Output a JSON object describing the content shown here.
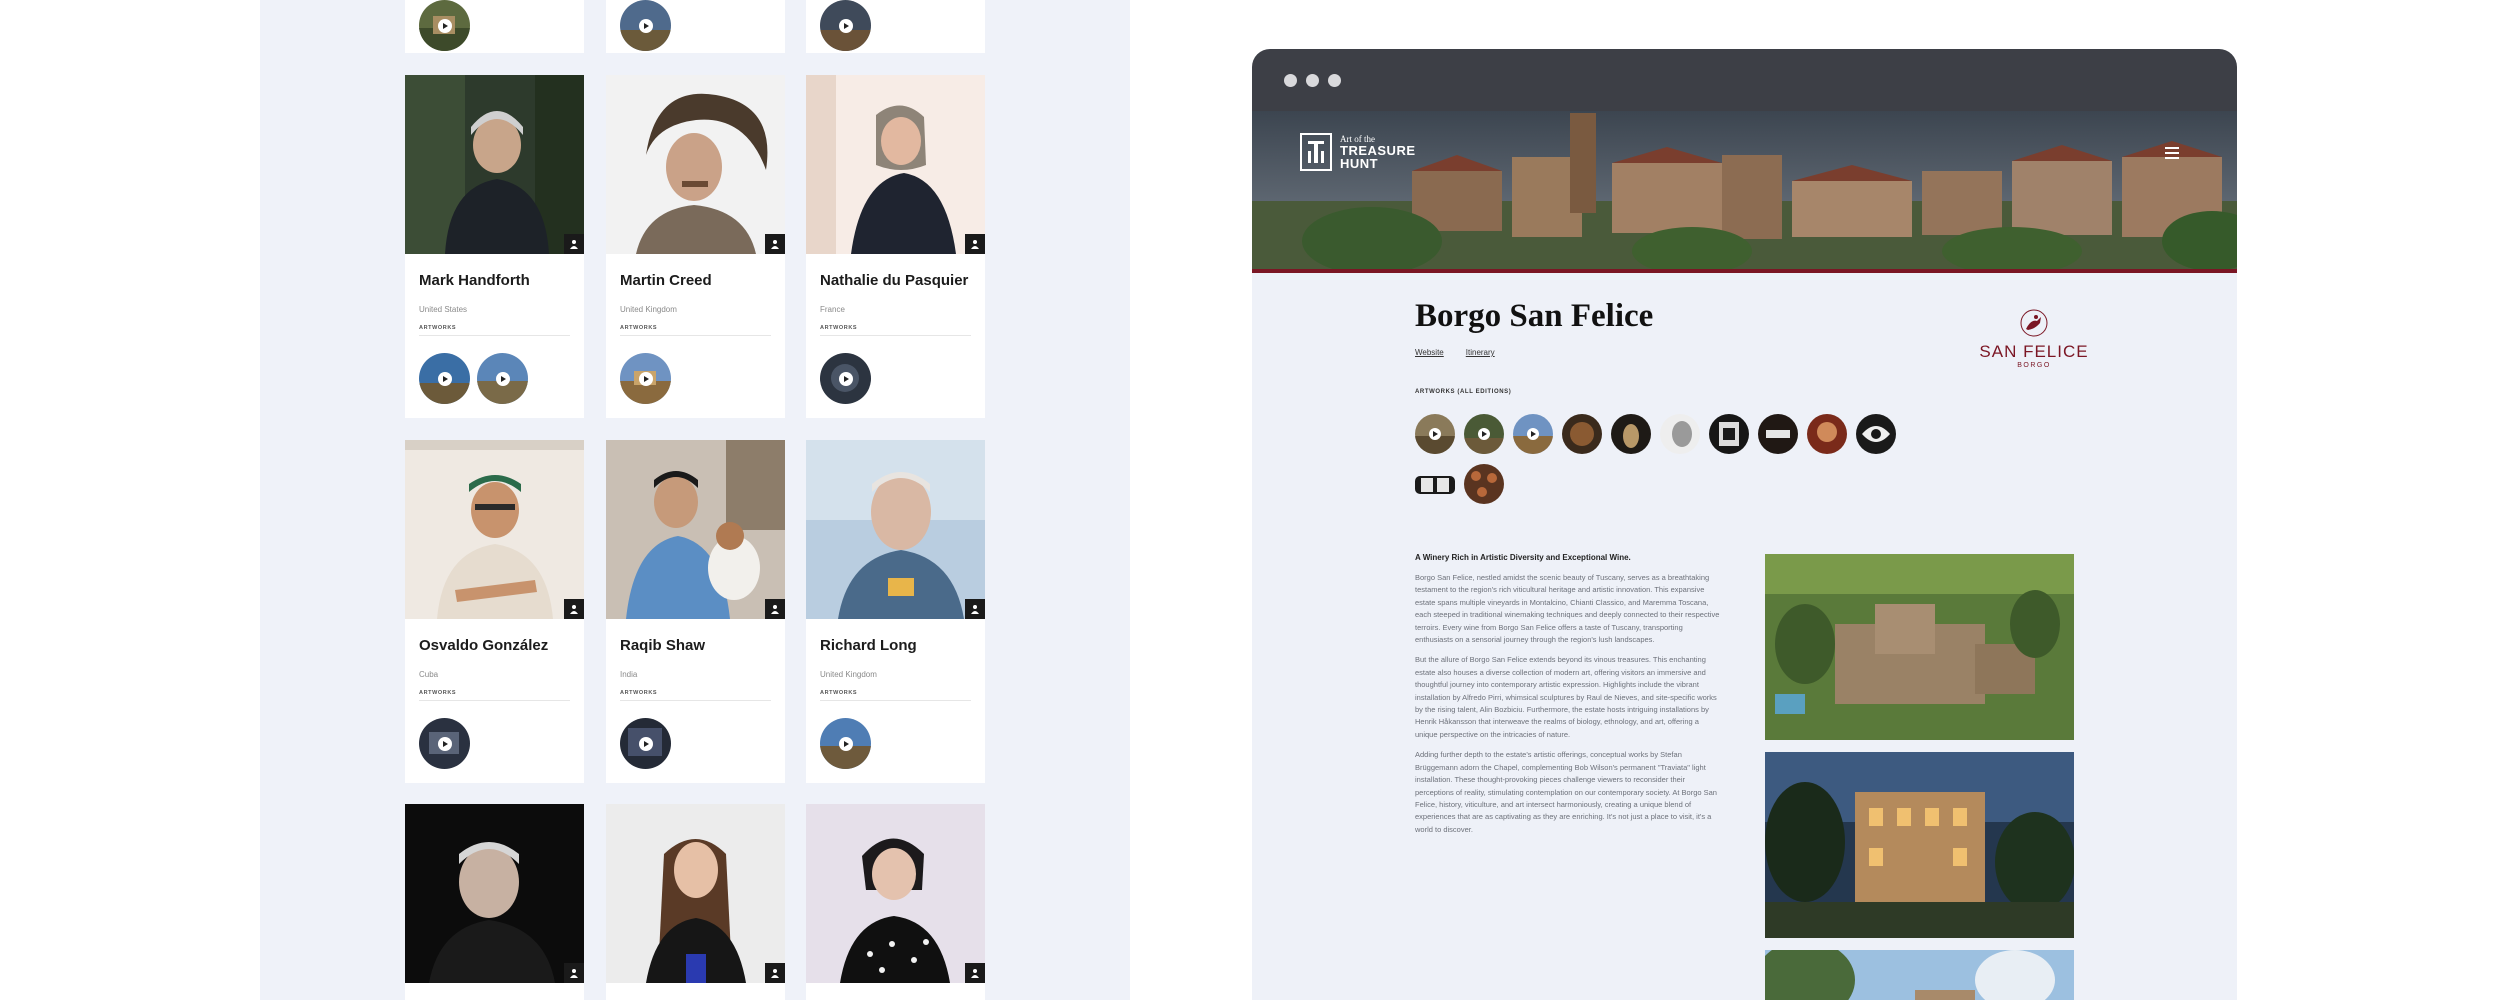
{
  "artists": [
    {
      "name": "Mark Handforth",
      "country": "United States",
      "artworks_label": "ARTWORKS",
      "artwork_count": 2
    },
    {
      "name": "Martin Creed",
      "country": "United Kingdom",
      "artworks_label": "ARTWORKS",
      "artwork_count": 1
    },
    {
      "name": "Nathalie du Pasquier",
      "country": "France",
      "artworks_label": "ARTWORKS",
      "artwork_count": 1
    },
    {
      "name": "Osvaldo González",
      "country": "Cuba",
      "artworks_label": "ARTWORKS",
      "artwork_count": 1
    },
    {
      "name": "Raqib Shaw",
      "country": "India",
      "artworks_label": "ARTWORKS",
      "artwork_count": 1
    },
    {
      "name": "Richard Long",
      "country": "United Kingdom",
      "artworks_label": "ARTWORKS",
      "artwork_count": 1
    }
  ],
  "browser": {
    "logo": {
      "line1": "Art of the",
      "line2": "TREASURE",
      "line3": "HUNT"
    },
    "page_title": "Borgo San Felice",
    "links": {
      "website": "Website",
      "itinerary": "Itinerary"
    },
    "brand": {
      "name": "SAN FELICE",
      "sub": "BORGO"
    },
    "artworks_label": "ARTWORKS (ALL EDITIONS)",
    "artwork_thumb_count": 12,
    "article": {
      "lead": "A Winery Rich in Artistic Diversity and Exceptional Wine.",
      "p1": "Borgo San Felice, nestled amidst the scenic beauty of Tuscany, serves as a breathtaking testament to the region's rich viticultural heritage and artistic innovation. This expansive estate spans multiple vineyards in Montalcino, Chianti Classico, and Maremma Toscana, each steeped in traditional winemaking techniques and deeply connected to their respective terroirs. Every wine from Borgo San Felice offers a taste of Tuscany, transporting enthusiasts on a sensorial journey through the region's lush landscapes.",
      "p2": "But the allure of Borgo San Felice extends beyond its vinous treasures. This enchanting estate also houses a diverse collection of modern art, offering visitors an immersive and thoughtful journey into contemporary artistic expression. Highlights include the vibrant installation by Alfredo Pirri, whimsical sculptures by Raul de Nieves, and site-specific works by the rising talent, Alin Bozbiciu. Furthermore, the estate hosts intriguing installations by Henrik Håkansson that interweave the realms of biology, ethnology, and art, offering a unique perspective on the intricacies of nature.",
      "p3": "Adding further depth to the estate's artistic offerings, conceptual works by Stefan Brüggemann adorn the Chapel, complementing Bob Wilson's permanent \"Traviata\" light installation. These thought-provoking pieces challenge viewers to reconsider their perceptions of reality, stimulating contemplation on our contemporary society. At Borgo San Felice, history, viticulture, and art intersect harmoniously, creating a unique blend of experiences that are as captivating as they are enriching. It's not just a place to visit, it's a world to discover."
    }
  },
  "colors": {
    "panel_bg": "#eff2f9",
    "browser_chrome": "#3d3f46",
    "brand_red": "#7b1624"
  }
}
